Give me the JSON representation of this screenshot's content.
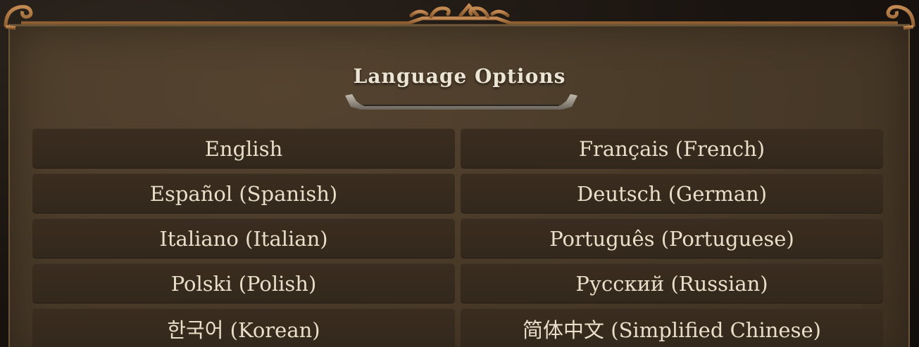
{
  "title": "Language Options",
  "colors": {
    "panel": "#4a3b29",
    "button": "#362a1e",
    "text": "#e9dfc8",
    "frame_accent": "#b07a45"
  },
  "languages": [
    {
      "label": "English"
    },
    {
      "label": "Français (French)"
    },
    {
      "label": "Español (Spanish)"
    },
    {
      "label": "Deutsch (German)"
    },
    {
      "label": "Italiano (Italian)"
    },
    {
      "label": "Português (Portuguese)"
    },
    {
      "label": "Polski (Polish)"
    },
    {
      "label": "Русский (Russian)"
    },
    {
      "label": "한국어 (Korean)"
    },
    {
      "label": "简体中文 (Simplified Chinese)"
    }
  ]
}
